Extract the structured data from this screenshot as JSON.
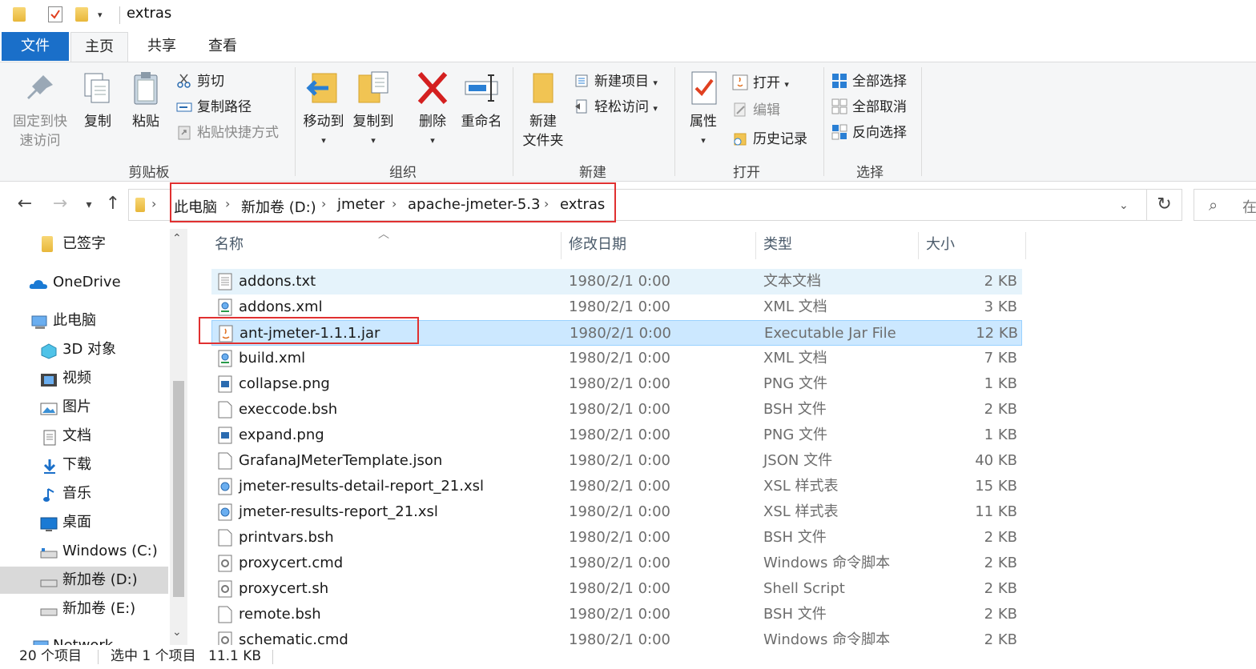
{
  "window": {
    "title": "extras"
  },
  "tabs": {
    "file": "文件",
    "home": "主页",
    "share": "共享",
    "view": "查看"
  },
  "ribbon": {
    "clipboard": {
      "label": "剪贴板",
      "pin_line1": "固定到快",
      "pin_line2": "速访问",
      "copy": "复制",
      "paste": "粘贴",
      "cut": "剪切",
      "copy_path": "复制路径",
      "paste_shortcut": "粘贴快捷方式"
    },
    "organize": {
      "label": "组织",
      "move_to": "移动到",
      "copy_to": "复制到",
      "delete": "删除",
      "rename": "重命名"
    },
    "new": {
      "label": "新建",
      "new_folder_line1": "新建",
      "new_folder_line2": "文件夹",
      "new_item": "新建项目",
      "easy_access": "轻松访问"
    },
    "open": {
      "label": "打开",
      "properties": "属性",
      "open": "打开",
      "edit": "编辑",
      "history": "历史记录"
    },
    "select": {
      "label": "选择",
      "select_all": "全部选择",
      "select_none": "全部取消",
      "invert": "反向选择"
    }
  },
  "address": {
    "crumbs": [
      "此电脑",
      "新加卷 (D:)",
      "jmeter",
      "apache-jmeter-5.3",
      "extras"
    ],
    "search_placeholder": "在"
  },
  "nav": [
    {
      "label": "已签字",
      "icon": "folder-icon"
    },
    {
      "label": "OneDrive",
      "icon": "onedrive-icon"
    },
    {
      "label": "此电脑",
      "icon": "pc-icon"
    },
    {
      "label": "3D 对象",
      "icon": "3d-objects-icon"
    },
    {
      "label": "视频",
      "icon": "video-icon"
    },
    {
      "label": "图片",
      "icon": "pictures-icon"
    },
    {
      "label": "文档",
      "icon": "documents-icon"
    },
    {
      "label": "下载",
      "icon": "download-icon"
    },
    {
      "label": "音乐",
      "icon": "music-icon"
    },
    {
      "label": "桌面",
      "icon": "desktop-icon"
    },
    {
      "label": "Windows (C:)",
      "icon": "drive-icon"
    },
    {
      "label": "新加卷 (D:)",
      "icon": "drive-icon"
    },
    {
      "label": "新加卷 (E:)",
      "icon": "drive-icon"
    },
    {
      "label": "Network",
      "icon": "network-icon"
    }
  ],
  "columns": {
    "name": "名称",
    "date": "修改日期",
    "type": "类型",
    "size": "大小"
  },
  "files": [
    {
      "name": "addons.txt",
      "date": "1980/2/1 0:00",
      "type": "文本文档",
      "size": "2 KB",
      "icon": "text-file-icon"
    },
    {
      "name": "addons.xml",
      "date": "1980/2/1 0:00",
      "type": "XML 文档",
      "size": "3 KB",
      "icon": "xml-file-icon"
    },
    {
      "name": "ant-jmeter-1.1.1.jar",
      "date": "1980/2/1 0:00",
      "type": "Executable Jar File",
      "size": "12 KB",
      "icon": "jar-file-icon"
    },
    {
      "name": "build.xml",
      "date": "1980/2/1 0:00",
      "type": "XML 文档",
      "size": "7 KB",
      "icon": "xml-file-icon"
    },
    {
      "name": "collapse.png",
      "date": "1980/2/1 0:00",
      "type": "PNG 文件",
      "size": "1 KB",
      "icon": "image-file-icon"
    },
    {
      "name": "execcode.bsh",
      "date": "1980/2/1 0:00",
      "type": "BSH 文件",
      "size": "2 KB",
      "icon": "blank-file-icon"
    },
    {
      "name": "expand.png",
      "date": "1980/2/1 0:00",
      "type": "PNG 文件",
      "size": "1 KB",
      "icon": "image-file-icon"
    },
    {
      "name": "GrafanaJMeterTemplate.json",
      "date": "1980/2/1 0:00",
      "type": "JSON 文件",
      "size": "40 KB",
      "icon": "blank-file-icon"
    },
    {
      "name": "jmeter-results-detail-report_21.xsl",
      "date": "1980/2/1 0:00",
      "type": "XSL 样式表",
      "size": "15 KB",
      "icon": "xsl-file-icon"
    },
    {
      "name": "jmeter-results-report_21.xsl",
      "date": "1980/2/1 0:00",
      "type": "XSL 样式表",
      "size": "11 KB",
      "icon": "xsl-file-icon"
    },
    {
      "name": "printvars.bsh",
      "date": "1980/2/1 0:00",
      "type": "BSH 文件",
      "size": "2 KB",
      "icon": "blank-file-icon"
    },
    {
      "name": "proxycert.cmd",
      "date": "1980/2/1 0:00",
      "type": "Windows 命令脚本",
      "size": "2 KB",
      "icon": "script-file-icon"
    },
    {
      "name": "proxycert.sh",
      "date": "1980/2/1 0:00",
      "type": "Shell Script",
      "size": "2 KB",
      "icon": "script-file-icon"
    },
    {
      "name": "remote.bsh",
      "date": "1980/2/1 0:00",
      "type": "BSH 文件",
      "size": "2 KB",
      "icon": "blank-file-icon"
    },
    {
      "name": "schematic.cmd",
      "date": "1980/2/1 0:00",
      "type": "Windows 命令脚本",
      "size": "2 KB",
      "icon": "script-file-icon"
    }
  ],
  "status": {
    "count": "20 个项目",
    "selected": "选中 1 个项目",
    "size": "11.1 KB"
  },
  "colors": {
    "accent": "#1a6fc9",
    "selection": "#cce8ff",
    "highlight_box": "#e03030"
  }
}
